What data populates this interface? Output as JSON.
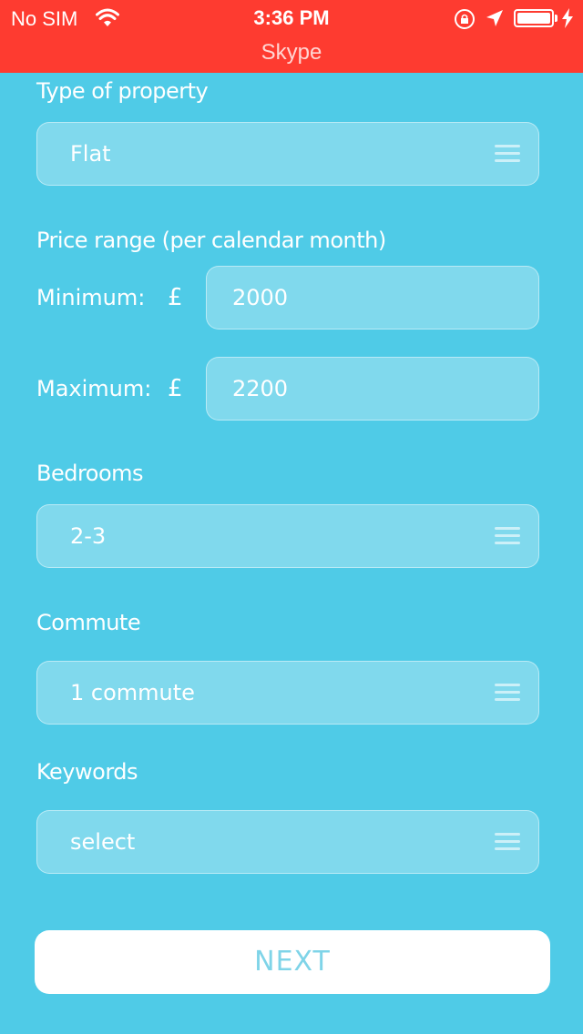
{
  "status_bar": {
    "carrier": "No SIM",
    "time": "3:36 PM",
    "app_name": "Skype",
    "icons": [
      "wifi-icon",
      "rotation-lock-icon",
      "location-arrow-icon",
      "battery-icon",
      "charging-bolt-icon"
    ]
  },
  "form": {
    "property_type": {
      "label": "Type of property",
      "value": "Flat"
    },
    "price_range": {
      "label": "Price range (per calendar month)",
      "currency": "£",
      "minimum": {
        "label": "Minimum:",
        "value": "2000"
      },
      "maximum": {
        "label": "Maximum:",
        "value": "2200"
      }
    },
    "bedrooms": {
      "label": "Bedrooms",
      "value": "2-3"
    },
    "commute": {
      "label": "Commute",
      "value": "1 commute"
    },
    "keywords": {
      "label": "Keywords",
      "value": "select"
    }
  },
  "next_label": "NEXT",
  "colors": {
    "status_bar": "#fe3b30",
    "background": "#4fcbe7",
    "button_text": "#7fd4e8"
  }
}
